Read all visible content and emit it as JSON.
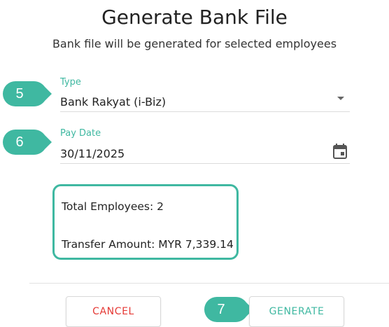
{
  "dialog": {
    "title": "Generate Bank File",
    "subtitle": "Bank file will be generated for selected employees"
  },
  "type_field": {
    "label": "Type",
    "value": "Bank Rakyat (i-Biz)",
    "icon": "dropdown-arrow-icon"
  },
  "pay_date_field": {
    "label": "Pay Date",
    "value": "30/11/2025",
    "icon": "calendar-icon"
  },
  "summary": {
    "total_employees": "Total Employees: 2",
    "transfer_amount": "Transfer Amount: MYR 7,339.14"
  },
  "actions": {
    "cancel_label": "CANCEL",
    "generate_label": "GENERATE"
  },
  "step_markers": {
    "type": "5",
    "pay_date": "6",
    "generate": "7"
  },
  "colors": {
    "accent": "#3fb8a1",
    "cancel": "#e53935",
    "generate": "#3fb8a1"
  }
}
